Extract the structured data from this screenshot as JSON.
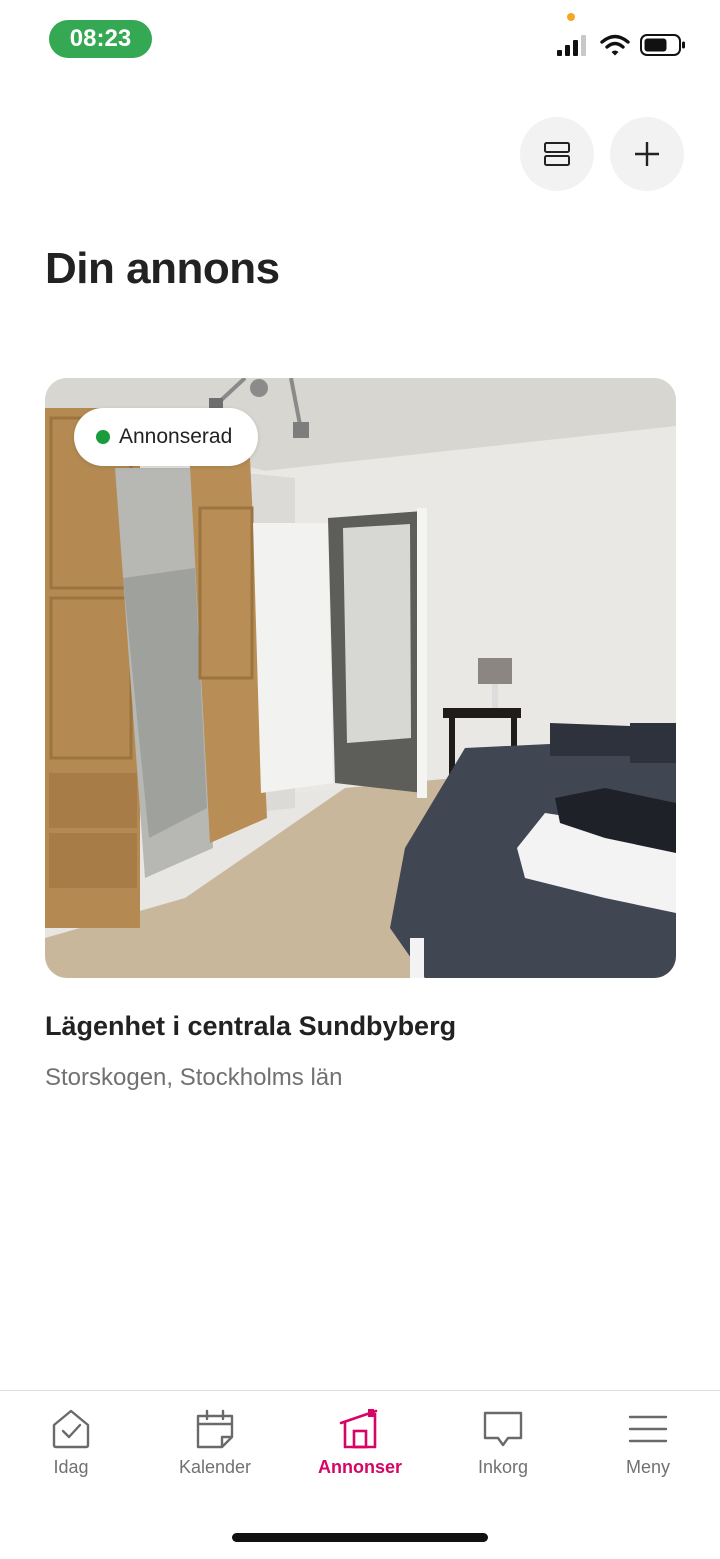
{
  "status_bar": {
    "time": "08:23",
    "time_pill_color": "#34a853",
    "icons": [
      "signal-icon",
      "wifi-icon",
      "battery-icon"
    ]
  },
  "header": {
    "actions": [
      {
        "name": "layout-icon"
      },
      {
        "name": "plus-icon"
      }
    ]
  },
  "page": {
    "title": "Din annons"
  },
  "listing": {
    "status": "Annonserad",
    "status_color": "#1a9c3c",
    "title": "Lägenhet i centrala Sundbyberg",
    "location": "Storskogen, Stockholms län"
  },
  "tab_bar": {
    "accent_color": "#d70466",
    "tabs": [
      {
        "label": "Idag",
        "icon": "today-icon",
        "active": false
      },
      {
        "label": "Kalender",
        "icon": "calendar-icon",
        "active": false
      },
      {
        "label": "Annonser",
        "icon": "listings-icon",
        "active": true
      },
      {
        "label": "Inkorg",
        "icon": "inbox-icon",
        "active": false
      },
      {
        "label": "Meny",
        "icon": "menu-icon",
        "active": false
      }
    ]
  }
}
